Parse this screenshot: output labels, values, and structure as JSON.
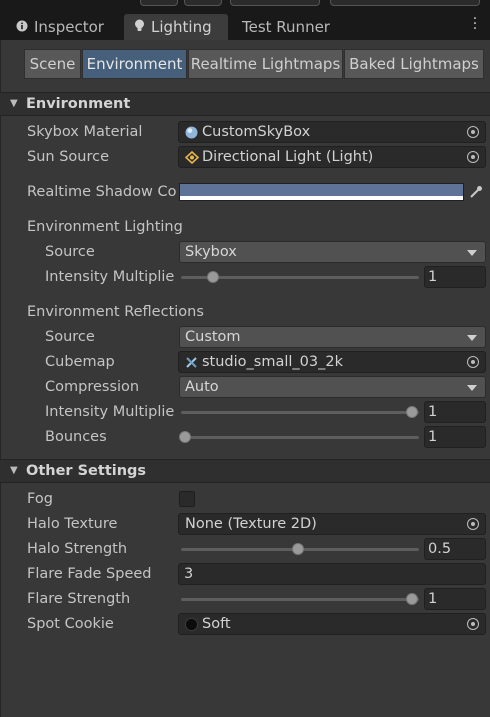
{
  "tabs": [
    {
      "label": "Inspector",
      "icon": "info-icon"
    },
    {
      "label": "Lighting",
      "icon": "lightbulb-icon"
    },
    {
      "label": "Test Runner",
      "icon": ""
    }
  ],
  "subtabs": [
    "Scene",
    "Environment",
    "Realtime Lightmaps",
    "Baked Lightmaps"
  ],
  "selected_subtab": "Environment",
  "environment": {
    "header": "Environment",
    "skybox_material": {
      "label": "Skybox Material",
      "value": "CustomSkyBox"
    },
    "sun_source": {
      "label": "Sun Source",
      "value": "Directional Light (Light)"
    },
    "realtime_shadow_color": {
      "label": "Realtime Shadow Co",
      "color": "#5f7398"
    },
    "env_lighting": {
      "header": "Environment Lighting",
      "source": {
        "label": "Source",
        "value": "Skybox"
      },
      "intensity": {
        "label": "Intensity Multiplier",
        "value": "1",
        "fraction": 0.14
      }
    },
    "env_reflections": {
      "header": "Environment Reflections",
      "source": {
        "label": "Source",
        "value": "Custom"
      },
      "cubemap": {
        "label": "Cubemap",
        "value": "studio_small_03_2k"
      },
      "compression": {
        "label": "Compression",
        "value": "Auto"
      },
      "intensity": {
        "label": "Intensity Multiplier",
        "value": "1",
        "fraction": 1.0
      },
      "bounces": {
        "label": "Bounces",
        "value": "1",
        "fraction": 0.0
      }
    }
  },
  "other": {
    "header": "Other Settings",
    "fog": {
      "label": "Fog",
      "checked": false
    },
    "halo_texture": {
      "label": "Halo Texture",
      "value": "None (Texture 2D)"
    },
    "halo_strength": {
      "label": "Halo Strength",
      "value": "0.5",
      "fraction": 0.5
    },
    "flare_fade_speed": {
      "label": "Flare Fade Speed",
      "value": "3"
    },
    "flare_strength": {
      "label": "Flare Strength",
      "value": "1",
      "fraction": 1.0
    },
    "spot_cookie": {
      "label": "Spot Cookie",
      "value": "Soft"
    }
  }
}
